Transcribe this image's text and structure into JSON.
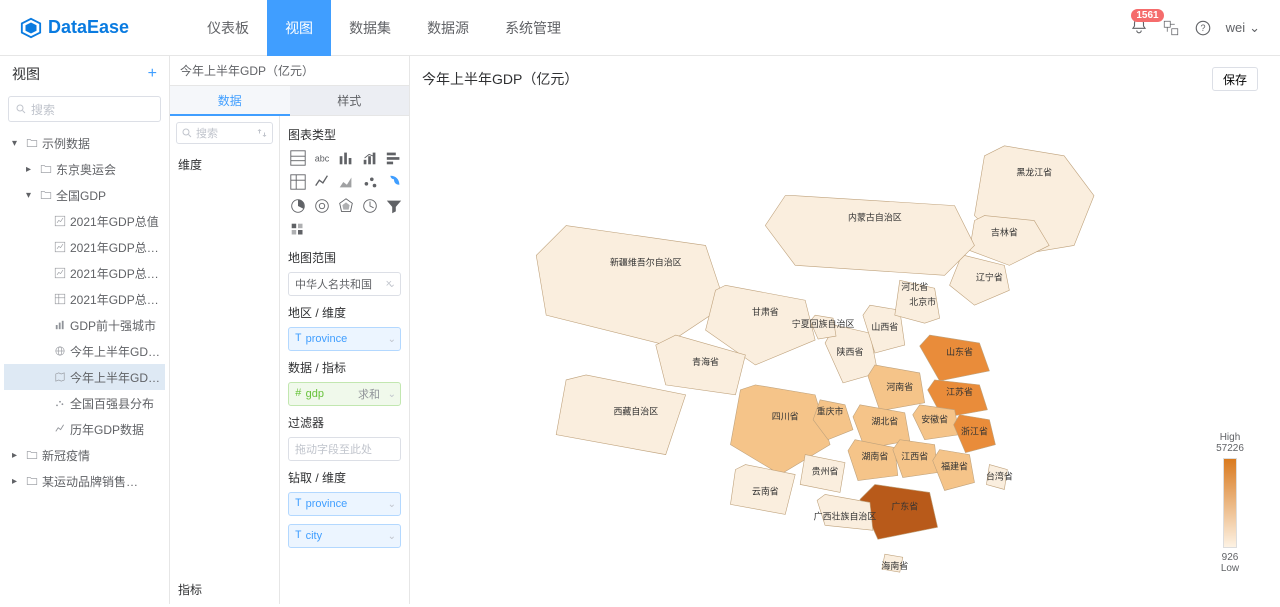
{
  "brand": "DataEase",
  "nav": [
    "仪表板",
    "视图",
    "数据集",
    "数据源",
    "系统管理"
  ],
  "nav_active": 1,
  "notif_count": "1561",
  "user": "wei",
  "sidebar": {
    "title": "视图",
    "search_ph": "搜索",
    "tree": [
      {
        "lvl": 0,
        "caret": "▾",
        "icon": "folder",
        "label": "示例数据"
      },
      {
        "lvl": 1,
        "caret": "▸",
        "icon": "folder",
        "label": "东京奥运会"
      },
      {
        "lvl": 1,
        "caret": "▾",
        "icon": "folder",
        "label": "全国GDP"
      },
      {
        "lvl": 2,
        "caret": "",
        "icon": "chart",
        "label": "2021年GDP总值"
      },
      {
        "lvl": 2,
        "caret": "",
        "icon": "chart",
        "label": "2021年GDP总…"
      },
      {
        "lvl": 2,
        "caret": "",
        "icon": "chart",
        "label": "2021年GDP总…"
      },
      {
        "lvl": 2,
        "caret": "",
        "icon": "table",
        "label": "2021年GDP总…"
      },
      {
        "lvl": 2,
        "caret": "",
        "icon": "bar",
        "label": "GDP前十强城市"
      },
      {
        "lvl": 2,
        "caret": "",
        "icon": "globe",
        "label": "今年上半年GD…"
      },
      {
        "lvl": 2,
        "caret": "",
        "icon": "map",
        "label": "今年上半年GD…",
        "selected": true
      },
      {
        "lvl": 2,
        "caret": "",
        "icon": "scatter",
        "label": "全国百强县分布"
      },
      {
        "lvl": 2,
        "caret": "",
        "icon": "line",
        "label": "历年GDP数据"
      },
      {
        "lvl": 0,
        "caret": "▸",
        "icon": "folder",
        "label": "新冠疫情"
      },
      {
        "lvl": 0,
        "caret": "▸",
        "icon": "folder",
        "label": "某运动品牌销售…"
      }
    ]
  },
  "crumb": "今年上半年GDP（亿元）",
  "save": "保存",
  "tabs": {
    "data": "数据",
    "style": "样式"
  },
  "mid_search_ph": "搜索",
  "dim_label": "维度",
  "metric_label": "指标",
  "panel": {
    "chart_type_label": "图表类型",
    "map_range_label": "地图范围",
    "map_range_val": "中华人名共和国",
    "region_dim_label": "地区 / 维度",
    "region_dim_val": "province",
    "data_metric_label": "数据 / 指标",
    "data_metric_val": "gdp",
    "agg": "求和",
    "filter_label": "过滤器",
    "filter_ph": "拖动字段至此处",
    "drill_label": "钻取 / 维度",
    "drill1": "province",
    "drill2": "city"
  },
  "canvas_title": "今年上半年GDP（亿元）",
  "legend": {
    "high": "High",
    "low": "Low",
    "max": "57226",
    "min": "926"
  },
  "provinces": [
    "黑龙江省",
    "吉林省",
    "辽宁省",
    "内蒙古自治区",
    "新疆维吾尔自治区",
    "甘肃省",
    "青海省",
    "西藏自治区",
    "四川省",
    "重庆市",
    "云南省",
    "贵州省",
    "陕西省",
    "山西省",
    "河南省",
    "湖北省",
    "湖南省",
    "江西省",
    "山东省",
    "江苏省",
    "安徽省",
    "浙江省",
    "福建省",
    "广东省",
    "广西壮族自治区",
    "海南省",
    "宁夏回族自治区",
    "北京市",
    "台湾省",
    "河北省"
  ],
  "chart_data": {
    "type": "map",
    "title": "今年上半年GDP（亿元）",
    "value_range": [
      926,
      57226
    ],
    "legend_labels": {
      "high": "High",
      "low": "Low"
    },
    "series": [
      {
        "name": "广东省",
        "tier": "very-high"
      },
      {
        "name": "江苏省",
        "tier": "high"
      },
      {
        "name": "山东省",
        "tier": "high"
      },
      {
        "name": "浙江省",
        "tier": "high"
      },
      {
        "name": "四川省",
        "tier": "medium"
      },
      {
        "name": "河南省",
        "tier": "medium"
      },
      {
        "name": "湖北省",
        "tier": "medium"
      },
      {
        "name": "福建省",
        "tier": "medium"
      },
      {
        "name": "湖南省",
        "tier": "medium"
      },
      {
        "name": "安徽省",
        "tier": "medium"
      },
      {
        "name": "重庆市",
        "tier": "medium"
      },
      {
        "name": "江西省",
        "tier": "medium"
      },
      {
        "name": "陕西省",
        "tier": "low"
      },
      {
        "name": "山西省",
        "tier": "low"
      },
      {
        "name": "辽宁省",
        "tier": "low"
      },
      {
        "name": "贵州省",
        "tier": "low"
      },
      {
        "name": "云南省",
        "tier": "low"
      },
      {
        "name": "广西壮族自治区",
        "tier": "low"
      },
      {
        "name": "河北省",
        "tier": "low"
      },
      {
        "name": "北京市",
        "tier": "low"
      },
      {
        "name": "内蒙古自治区",
        "tier": "very-low"
      },
      {
        "name": "新疆维吾尔自治区",
        "tier": "very-low"
      },
      {
        "name": "甘肃省",
        "tier": "very-low"
      },
      {
        "name": "青海省",
        "tier": "very-low"
      },
      {
        "name": "西藏自治区",
        "tier": "very-low"
      },
      {
        "name": "黑龙江省",
        "tier": "very-low"
      },
      {
        "name": "吉林省",
        "tier": "very-low"
      },
      {
        "name": "宁夏回族自治区",
        "tier": "very-low"
      },
      {
        "name": "海南省",
        "tier": "very-low"
      },
      {
        "name": "台湾省",
        "tier": "very-low"
      }
    ]
  }
}
